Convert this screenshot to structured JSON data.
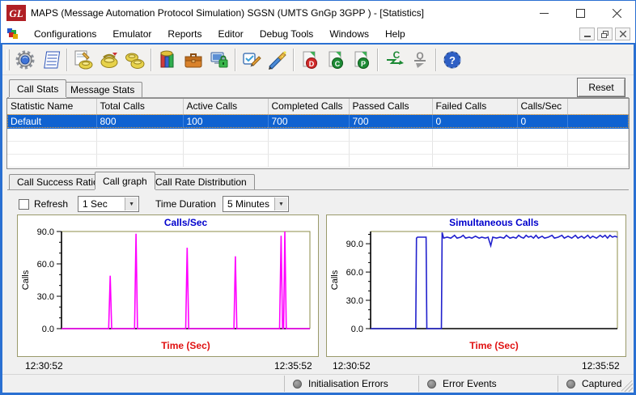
{
  "window": {
    "title": "MAPS (Message Automation Protocol Simulation) SGSN (UMTS GnGp 3GPP ) - [Statistics]",
    "logo_text": "GL",
    "controls": [
      "minimize",
      "maximize",
      "close"
    ],
    "mdi_controls": [
      "minimize",
      "restore",
      "close"
    ]
  },
  "menu": {
    "items": [
      "Configurations",
      "Emulator",
      "Reports",
      "Editor",
      "Debug Tools",
      "Windows",
      "Help"
    ]
  },
  "toolbar": {
    "icons": [
      "testbed-setup-icon",
      "profile-log-icon",
      "script-editor-icon",
      "call-generation-icon",
      "call-reception-icon",
      "statistics-icon",
      "profiles-briefcase-icon",
      "remote-secure-icon",
      "script-verify-icon",
      "script-wizard-icon",
      "start-d-icon",
      "start-c-icon",
      "start-p-icon",
      "continue-icon",
      "stop-icon",
      "help-icon"
    ]
  },
  "stats_tabs": {
    "tab1": "Call Stats",
    "tab2": "Message Stats"
  },
  "reset_button": "Reset",
  "table": {
    "columns": [
      "Statistic Name",
      "Total Calls",
      "Active Calls",
      "Completed Calls",
      "Passed Calls",
      "Failed Calls",
      "Calls/Sec"
    ],
    "row": {
      "name": "Default",
      "total": "800",
      "active": "100",
      "completed": "700",
      "passed": "700",
      "failed": "0",
      "cps": "0"
    }
  },
  "graph_tabs": {
    "tab1": "Call Success Ratio",
    "tab2": "Call graph",
    "tab3": "Call Rate Distribution"
  },
  "controls": {
    "refresh_label": "Refresh",
    "refresh_checked": false,
    "interval_value": "1 Sec",
    "duration_label": "Time Duration",
    "duration_value": "5 Minutes"
  },
  "chart_data": [
    {
      "type": "line",
      "title": "Calls/Sec",
      "xlabel": "Time (Sec)",
      "ylabel": "Calls",
      "x_start_label": "12:30:52",
      "x_end_label": "12:35:52",
      "yticks": [
        0,
        30,
        60,
        90
      ],
      "ytick_labels": [
        "0.0",
        "30.0",
        "60.0",
        "90.0"
      ],
      "ylim": [
        0,
        90
      ],
      "line_color": "#ff00ff",
      "title_color": "#0000cc",
      "xlabel_color": "#e01212",
      "grid": false,
      "legend": "none",
      "points": [
        [
          0,
          0
        ],
        [
          0.19,
          0
        ],
        [
          0.196,
          49
        ],
        [
          0.202,
          0
        ],
        [
          0.294,
          0
        ],
        [
          0.3,
          88
        ],
        [
          0.306,
          0
        ],
        [
          0.5,
          0
        ],
        [
          0.506,
          75
        ],
        [
          0.512,
          0
        ],
        [
          0.694,
          0
        ],
        [
          0.7,
          67
        ],
        [
          0.706,
          0
        ],
        [
          0.878,
          0
        ],
        [
          0.884,
          86
        ],
        [
          0.89,
          0
        ],
        [
          0.894,
          0
        ],
        [
          0.899,
          90
        ],
        [
          0.905,
          0
        ],
        [
          1,
          0
        ]
      ]
    },
    {
      "type": "line",
      "title": "Simultaneous Calls",
      "xlabel": "Time (Sec)",
      "ylabel": "Calls",
      "x_start_label": "12:30:52",
      "x_end_label": "12:35:52",
      "yticks": [
        0,
        30,
        60,
        90
      ],
      "ytick_labels": [
        "0.0",
        "30.0",
        "60.0",
        "90.0"
      ],
      "ylim": [
        0,
        103
      ],
      "line_color": "#2121cd",
      "title_color": "#0000cc",
      "xlabel_color": "#e01212",
      "grid": false,
      "legend": "none",
      "points": [
        [
          0,
          0
        ],
        [
          0.183,
          0
        ],
        [
          0.186,
          96
        ],
        [
          0.19,
          97
        ],
        [
          0.225,
          97
        ],
        [
          0.228,
          0
        ],
        [
          0.287,
          0
        ],
        [
          0.29,
          102
        ],
        [
          0.296,
          96
        ],
        [
          0.31,
          97
        ],
        [
          0.325,
          96
        ],
        [
          0.34,
          99
        ],
        [
          0.35,
          96
        ],
        [
          0.365,
          97
        ],
        [
          0.375,
          99
        ],
        [
          0.385,
          96
        ],
        [
          0.4,
          97
        ],
        [
          0.41,
          96
        ],
        [
          0.425,
          98
        ],
        [
          0.44,
          96
        ],
        [
          0.45,
          97
        ],
        [
          0.465,
          96
        ],
        [
          0.476,
          97
        ],
        [
          0.487,
          88
        ],
        [
          0.495,
          97
        ],
        [
          0.51,
          96
        ],
        [
          0.525,
          97
        ],
        [
          0.54,
          96
        ],
        [
          0.55,
          99
        ],
        [
          0.565,
          96
        ],
        [
          0.578,
          97
        ],
        [
          0.59,
          96
        ],
        [
          0.6,
          99
        ],
        [
          0.61,
          97
        ],
        [
          0.62,
          96
        ],
        [
          0.63,
          99
        ],
        [
          0.64,
          97
        ],
        [
          0.65,
          98
        ],
        [
          0.66,
          96
        ],
        [
          0.67,
          99
        ],
        [
          0.68,
          96
        ],
        [
          0.695,
          98
        ],
        [
          0.705,
          96
        ],
        [
          0.72,
          97
        ],
        [
          0.735,
          99
        ],
        [
          0.745,
          96
        ],
        [
          0.76,
          97
        ],
        [
          0.775,
          99
        ],
        [
          0.785,
          96
        ],
        [
          0.8,
          98
        ],
        [
          0.815,
          96
        ],
        [
          0.83,
          99
        ],
        [
          0.84,
          96
        ],
        [
          0.855,
          98
        ],
        [
          0.865,
          96
        ],
        [
          0.88,
          99
        ],
        [
          0.89,
          96
        ],
        [
          0.9,
          98
        ],
        [
          0.915,
          96
        ],
        [
          0.93,
          99
        ],
        [
          0.94,
          97
        ],
        [
          0.95,
          99
        ],
        [
          0.96,
          96
        ],
        [
          0.97,
          99
        ],
        [
          0.98,
          97
        ],
        [
          0.99,
          98
        ],
        [
          1,
          97
        ]
      ]
    }
  ],
  "status_bar": {
    "items": [
      {
        "label": "Initialisation Errors"
      },
      {
        "label": "Error Events"
      },
      {
        "label": "Captured"
      }
    ]
  },
  "colors": {
    "frame_blue": "#2a70d2",
    "selection_blue": "#0f62d1",
    "spike_magenta": "#ff00ff",
    "line_blue": "#2121cd",
    "chart_title_blue": "#0000cc",
    "axis_label_red": "#e01212",
    "panel_olive": "#9a9a6b"
  }
}
